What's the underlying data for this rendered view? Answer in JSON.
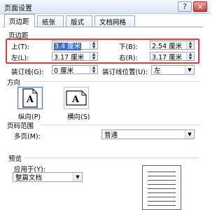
{
  "window": {
    "title": "页面设置",
    "help_label": "?",
    "close_label": "×"
  },
  "tabs": [
    {
      "label": "页边距",
      "active": true
    },
    {
      "label": "纸张",
      "active": false
    },
    {
      "label": "版式",
      "active": false
    },
    {
      "label": "文档网格",
      "active": false
    }
  ],
  "margins": {
    "section_label": "页边距",
    "top_label": "上(T):",
    "top_value": "3.4 厘米",
    "bottom_label": "下(B):",
    "bottom_value": "2.54 厘米",
    "left_label": "左(L):",
    "left_value": "3.17 厘米",
    "right_label": "右(R):",
    "right_value": "3.17 厘米",
    "gutter_label": "装订线(G):",
    "gutter_value": "0 厘米",
    "gutter_pos_label": "装订线位置(U):",
    "gutter_pos_value": "左"
  },
  "orientation": {
    "section_label": "方向",
    "portrait_label": "纵向(P)",
    "landscape_label": "横向(S)",
    "selected": "portrait",
    "portrait_glyph": "A",
    "landscape_glyph": "A"
  },
  "pages": {
    "section_label": "页码范围",
    "multiple_label": "多页(M):",
    "multiple_value": "普通"
  },
  "preview": {
    "section_label": "预览",
    "apply_label": "应用于(Y):",
    "apply_value": "整篇文档"
  },
  "colors": {
    "highlight": "#e23a3a",
    "selection": "#3a6fcf"
  }
}
